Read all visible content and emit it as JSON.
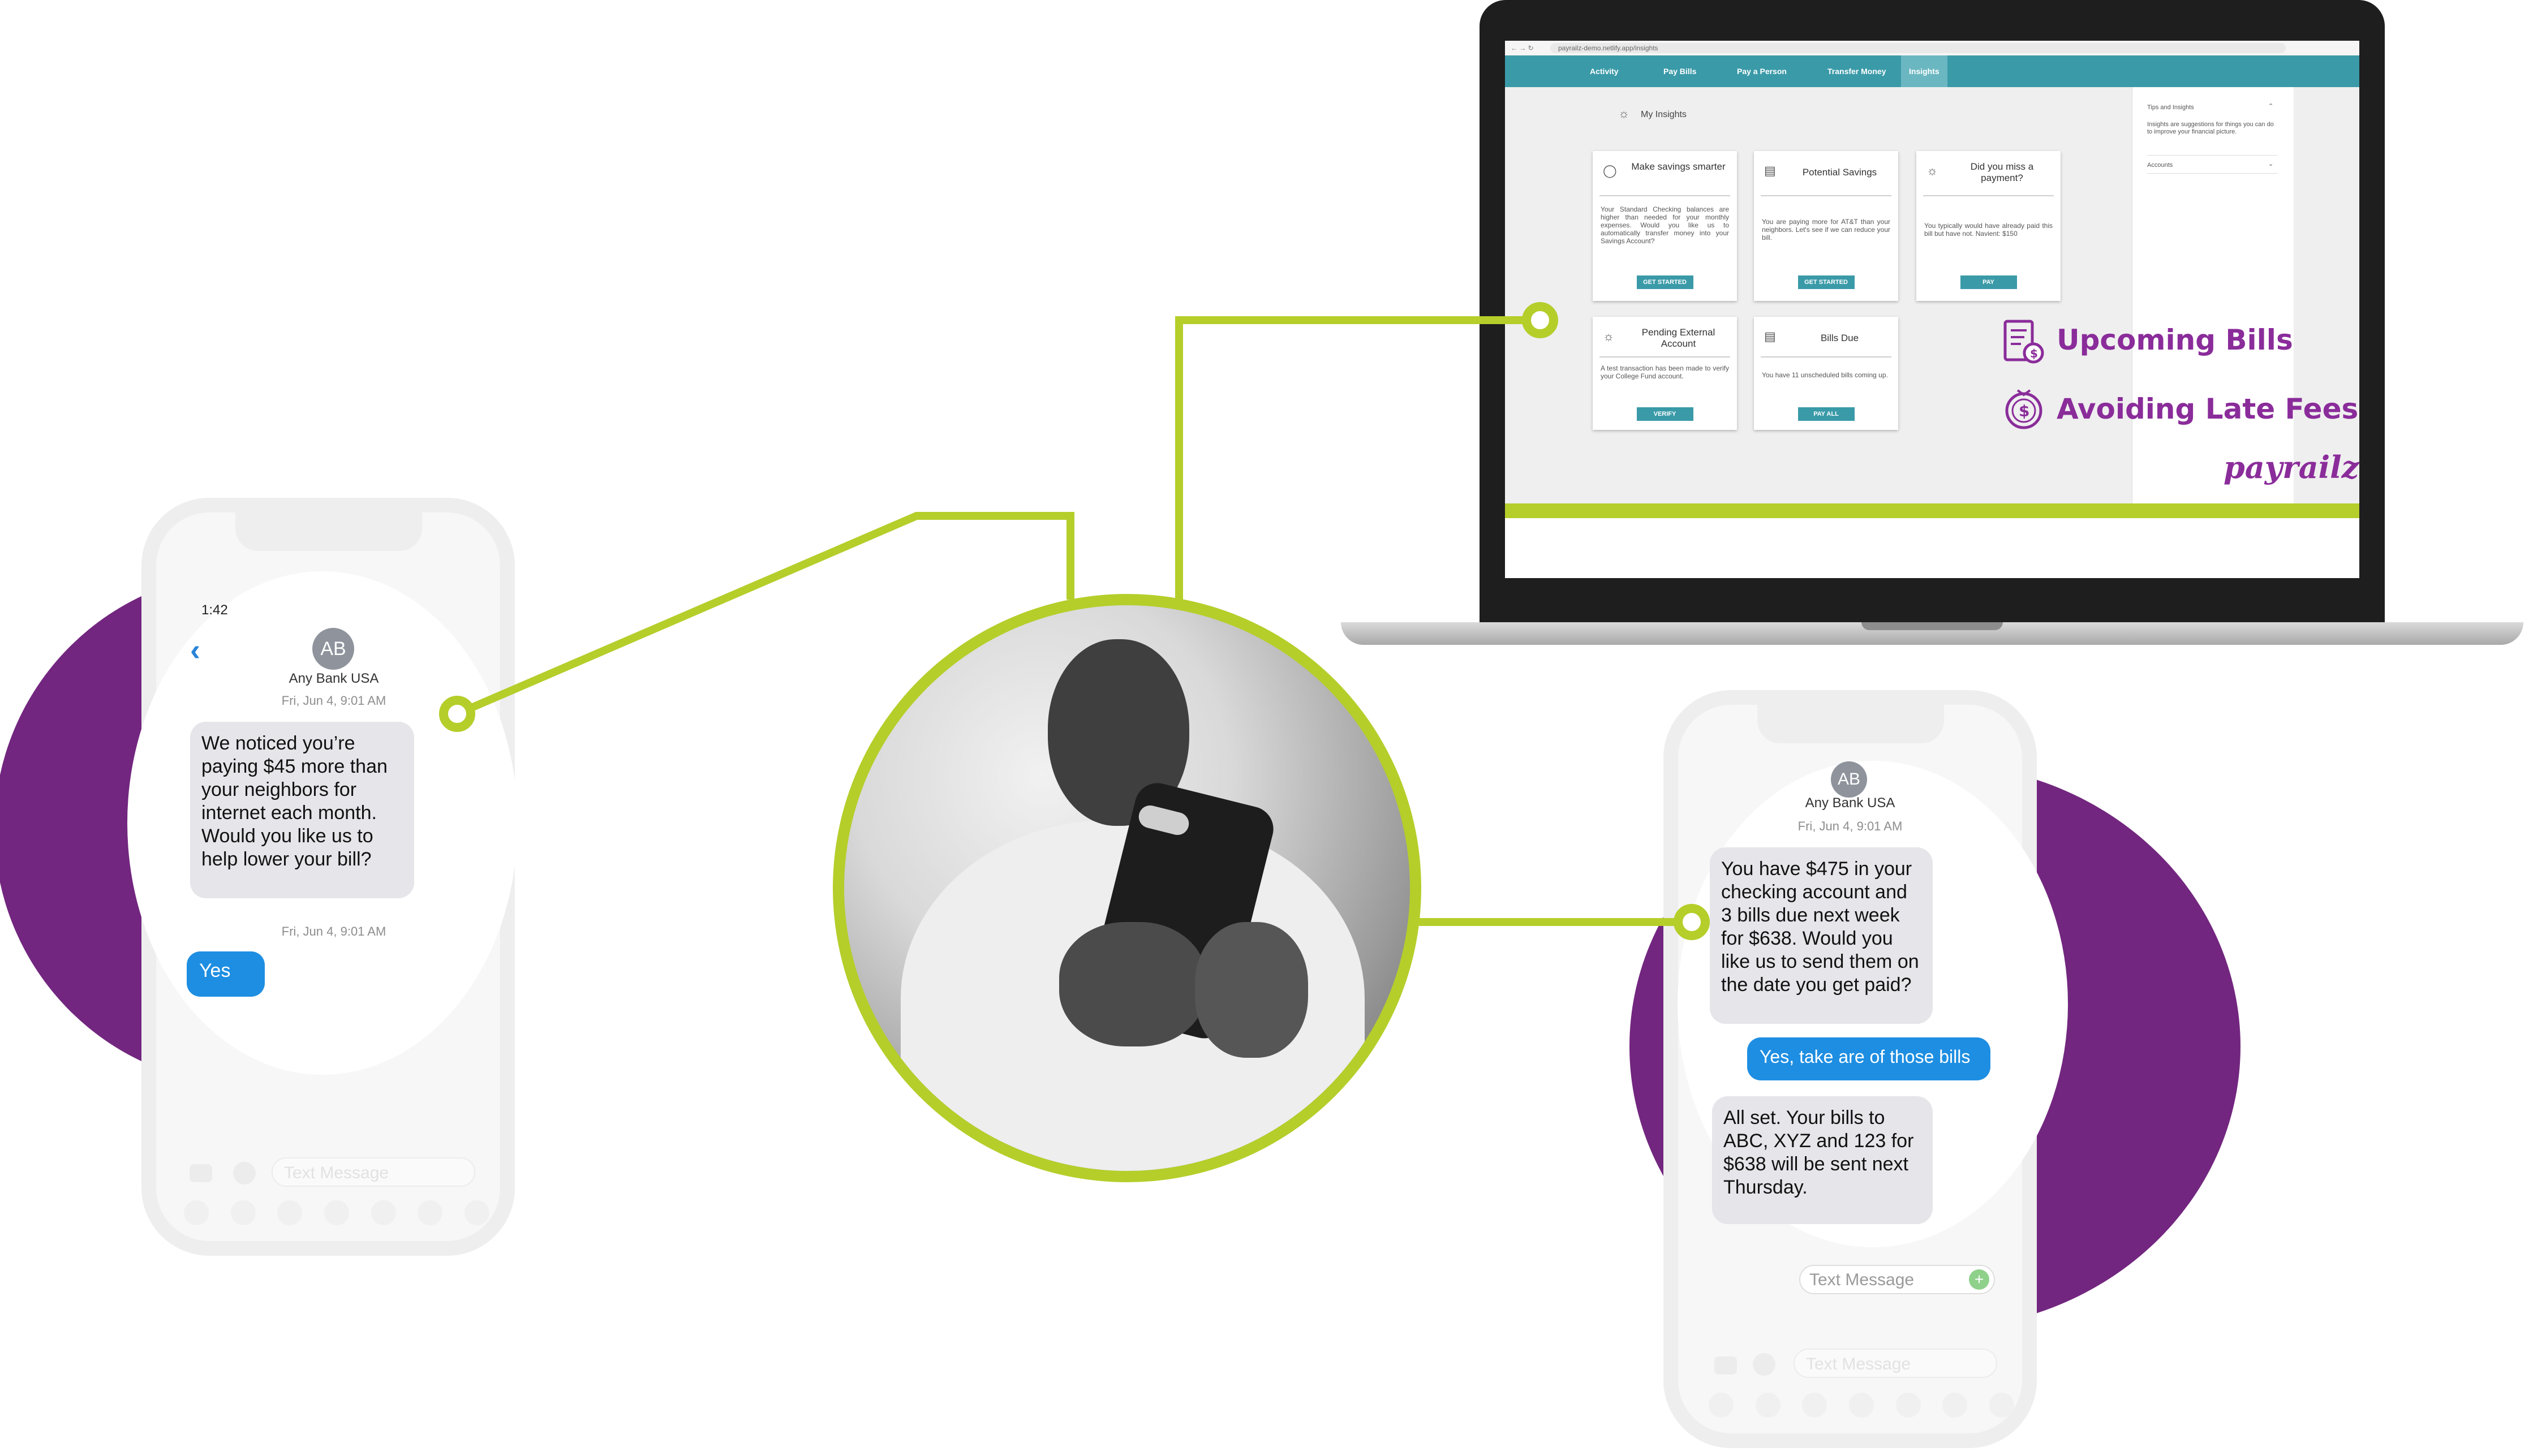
{
  "colors": {
    "brand_purple": "#72267f",
    "accent_green": "#b5ce2a",
    "teal_nav": "#3a9aa8",
    "imessage_blue": "#1e8ee2",
    "imessage_gray": "#e5e5ea"
  },
  "left_phone": {
    "status_time": "1:42",
    "back_icon": "chevron-left-icon",
    "avatar_initials": "AB",
    "contact_name": "Any Bank USA",
    "timestamp_1": "Fri, Jun 4, 9:01 AM",
    "incoming_message": "We noticed you’re paying $45 more than your neighbors for internet each month. Would you like us to help lower your bill?",
    "timestamp_2": "Fri, Jun 4, 9:01 AM",
    "outgoing_message": "Yes",
    "input_placeholder": "Text Message"
  },
  "right_phone": {
    "avatar_initials": "AB",
    "contact_name": "Any Bank USA",
    "timestamp": "Fri, Jun 4, 9:01 AM",
    "incoming_message_1": "You have $475 in your checking account and 3 bills due next week for $638. Would you like us to send them on the date you get paid?",
    "outgoing_message": "Yes, take are of those bills",
    "incoming_message_2": "All set. Your bills to ABC, XYZ and 123 for $638 will be sent next Thursday.",
    "input_placeholder": "Text Message",
    "input_placeholder_faint": "Text Message"
  },
  "laptop": {
    "url": "payrailz-demo.netlify.app/insights",
    "nav": [
      "Activity",
      "Pay Bills",
      "Pay a Person",
      "Transfer Money",
      "Insights"
    ],
    "active_nav": "Insights",
    "page_title": "My Insights",
    "cards": [
      {
        "title": "Make savings smarter",
        "body": "Your Standard Checking balances are higher than needed for your monthly expenses. Would you like us to automatically transfer money into your Savings Account?",
        "button": "GET STARTED"
      },
      {
        "title": "Potential Savings",
        "body": "You are paying more for AT&T than your neighbors. Let's see if we can reduce your bill.",
        "button": "GET STARTED"
      },
      {
        "title": "Did you miss a payment?",
        "body": "You typically would have already paid this bill but have not. Navient: $150",
        "button": "PAY"
      },
      {
        "title": "Pending External Account",
        "body": "A test transaction has been made to verify your College Fund account.",
        "button": "VERIFY"
      },
      {
        "title": "Bills Due",
        "body": "You have 11 unscheduled bills coming up.",
        "button": "PAY ALL"
      }
    ],
    "side_panel": {
      "heading": "Tips and Insights",
      "text": "Insights are suggestions for things you can do to improve your financial picture.",
      "accounts_label": "Accounts"
    },
    "features": [
      {
        "label": "Upcoming Bills",
        "icon": "bill-document-icon"
      },
      {
        "label": "Avoiding Late Fees",
        "icon": "dollar-coin-icon"
      }
    ],
    "logo_text": "payrailz"
  }
}
